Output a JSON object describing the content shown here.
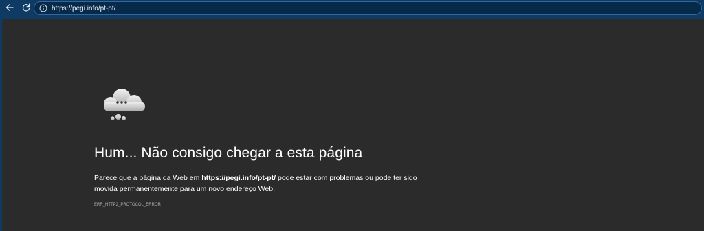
{
  "browser": {
    "url": "https://pegi.info/pt-pt/"
  },
  "error_page": {
    "heading": "Hum... Não consigo chegar a esta página",
    "desc_prefix": "Parece que a página da Web em ",
    "desc_url": "https://pegi.info/pt-pt/",
    "desc_suffix": " pode estar com problemas ou pode ter sido movida permanentemente para um novo endereço Web.",
    "error_code": "ERR_HTTP2_PROTOCOL_ERROR"
  },
  "icons": {
    "back": "back-arrow-icon",
    "refresh": "refresh-icon",
    "info": "info-icon",
    "cloud": "thinking-cloud-icon"
  },
  "colors": {
    "toolbar_bg": "#0f3a63",
    "page_bg": "#2b2b2b",
    "text": "#ffffff",
    "error_code": "#a9a9a9"
  }
}
